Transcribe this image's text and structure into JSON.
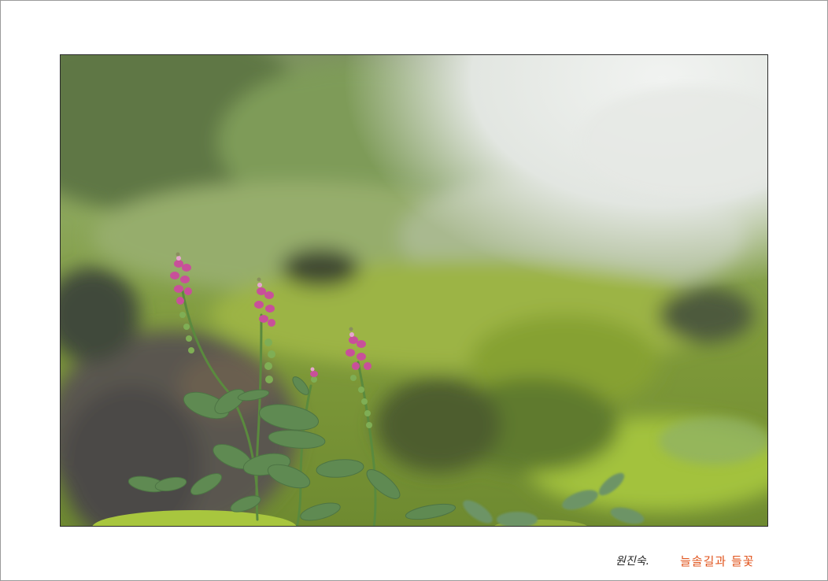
{
  "photo": {
    "subject": "pink-flowered-plant-icon",
    "colors": {
      "flower": "#c8509a",
      "leaf": "#5f8a52",
      "moss": "#9ab83a",
      "sky": "#e9ece9",
      "rock": "#5a5650"
    }
  },
  "caption": {
    "author": "원진숙.",
    "title": "늘솔길과 들꽃",
    "title_color": "#e0521a"
  }
}
